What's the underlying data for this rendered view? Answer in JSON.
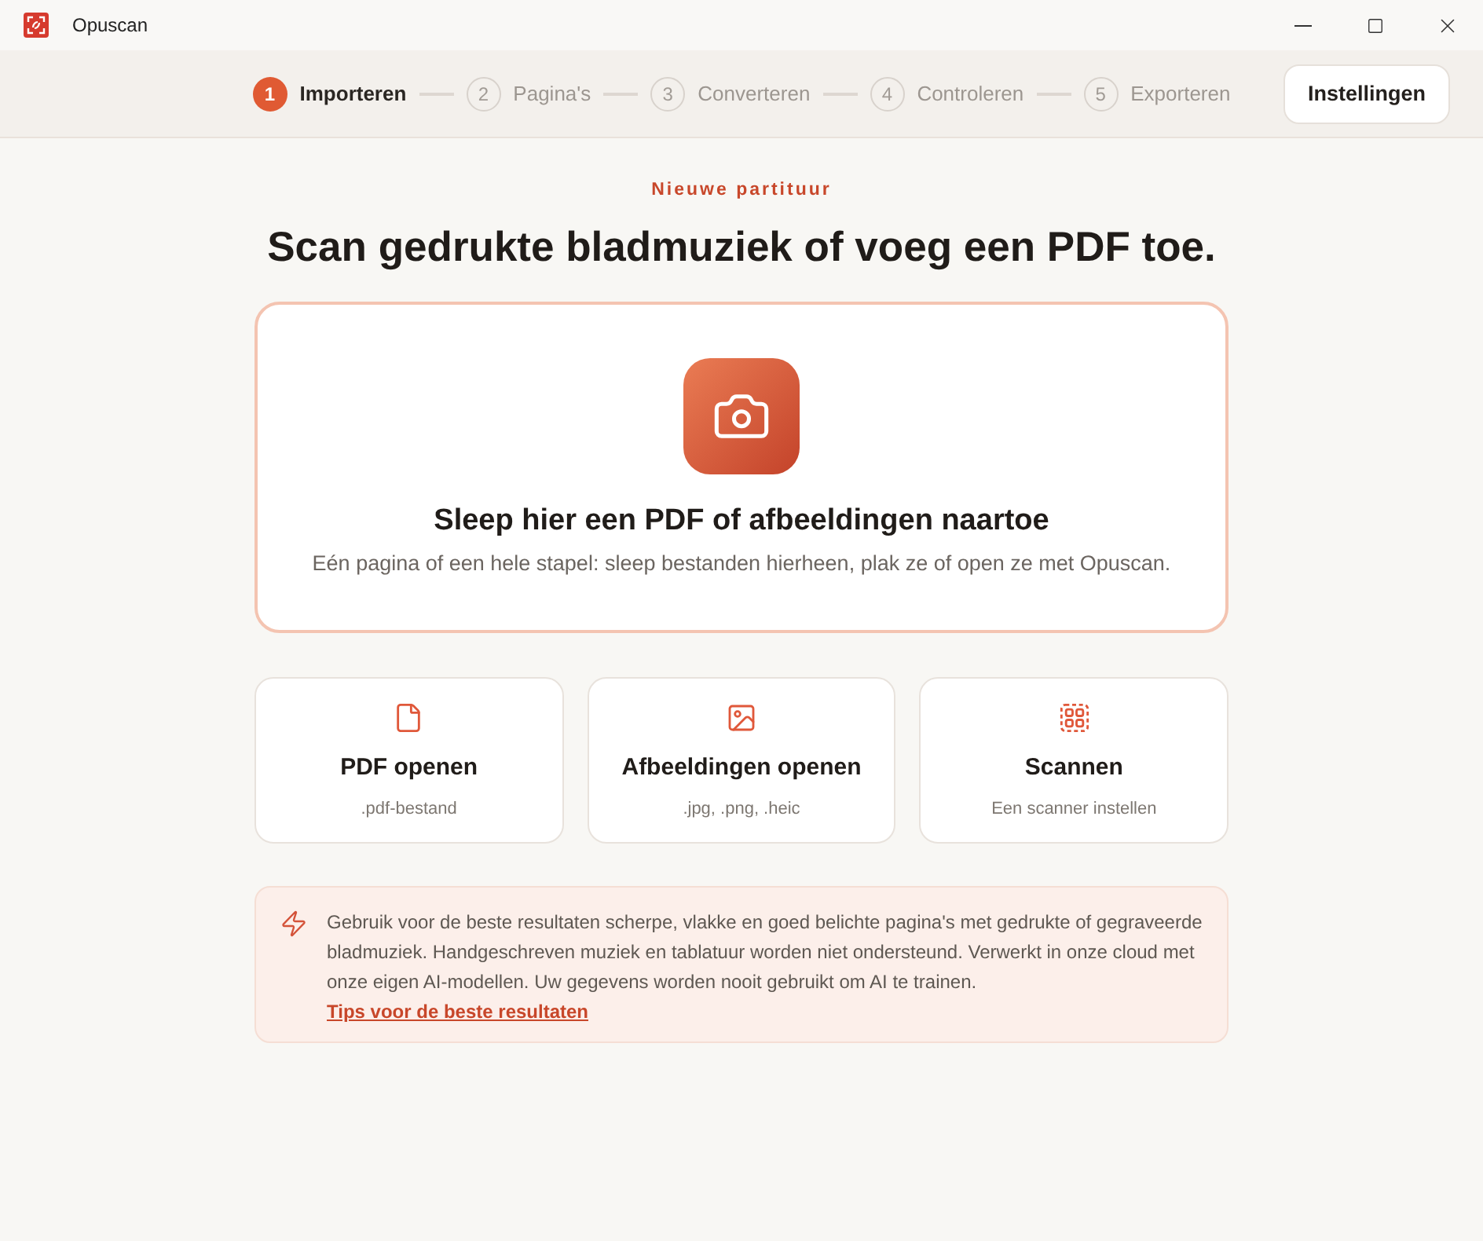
{
  "window": {
    "title": "Opuscan"
  },
  "steps": [
    {
      "number": "1",
      "label": "Importeren",
      "selected": true
    },
    {
      "number": "2",
      "label": "Pagina's",
      "selected": false
    },
    {
      "number": "3",
      "label": "Converteren",
      "selected": false
    },
    {
      "number": "4",
      "label": "Controleren",
      "selected": false
    },
    {
      "number": "5",
      "label": "Exporteren",
      "selected": false
    }
  ],
  "header": {
    "settings_button": "Instellingen"
  },
  "intro": {
    "eyebrow": "Nieuwe partituur",
    "heading": "Scan gedrukte bladmuziek of voeg een PDF toe."
  },
  "drop_zone": {
    "title": "Sleep hier een PDF of afbeeldingen naartoe",
    "subtitle": "Eén pagina of een hele stapel: sleep bestanden hierheen, plak ze of open ze met Opuscan."
  },
  "options": [
    {
      "kind": "pdf",
      "title": "PDF openen",
      "subtitle": ".pdf-bestand"
    },
    {
      "kind": "images",
      "title": "Afbeeldingen openen",
      "subtitle": ".jpg, .png, .heic"
    },
    {
      "kind": "scanner",
      "title": "Scannen",
      "subtitle": "Een scanner instellen"
    }
  ],
  "notice": {
    "text": "Gebruik voor de beste resultaten scherpe, vlakke en goed belichte pagina's met gedrukte of gegraveerde bladmuziek. Handgeschreven muziek en tablatuur worden niet ondersteund. Verwerkt in onze cloud met onze eigen AI-modellen. Uw gegevens worden nooit gebruikt om AI te trainen.",
    "link": "Tips voor de beste resultaten"
  }
}
